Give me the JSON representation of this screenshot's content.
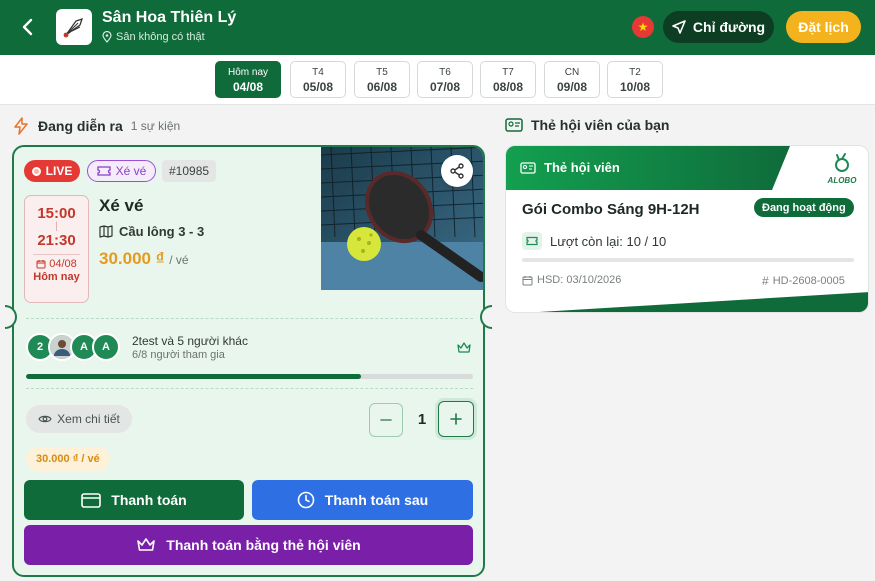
{
  "header": {
    "venue_name": "Sân Hoa Thiên Lý",
    "venue_subtitle": "Sân không có thật",
    "directions_label": "Chỉ đường",
    "book_label": "Đặt lịch",
    "flag_icon": "vietnam-flag-icon"
  },
  "dates": [
    {
      "dow": "Hôm nay",
      "date": "04/08",
      "active": true
    },
    {
      "dow": "T4",
      "date": "05/08",
      "active": false
    },
    {
      "dow": "T5",
      "date": "06/08",
      "active": false
    },
    {
      "dow": "T6",
      "date": "07/08",
      "active": false
    },
    {
      "dow": "T7",
      "date": "08/08",
      "active": false
    },
    {
      "dow": "CN",
      "date": "09/08",
      "active": false
    },
    {
      "dow": "T2",
      "date": "10/08",
      "active": false
    }
  ],
  "live_section": {
    "title": "Đang diễn ra",
    "count": "1 sự kiện"
  },
  "event": {
    "live_label": "LIVE",
    "ticket_tag": "Xé vé",
    "code": "#10985",
    "start_time": "15:00",
    "end_time": "21:30",
    "date": "04/08",
    "day_label": "Hôm nay",
    "name": "Xé vé",
    "court": "Cầu lông 3 - 3",
    "price": "30.000 ₫",
    "price_unit": "/ vé",
    "avatars": [
      {
        "text": "2",
        "color": "#1f8a55"
      },
      {
        "text": "",
        "color": "#7a8a80"
      },
      {
        "text": "A",
        "color": "#1f8a55"
      },
      {
        "text": "A",
        "color": "#1f8a55"
      }
    ],
    "participants_main": "2test và 5 người khác",
    "participants_sub": "6/8 người tham gia",
    "fill_fraction": 0.75,
    "detail_label": "Xem chi tiết",
    "quantity": "1",
    "sub_price": "30.000 ₫ / vé",
    "pay_label": "Thanh toán",
    "pay_later_label": "Thanh toán sau",
    "pay_member_label": "Thanh toán bằng thẻ hội viên"
  },
  "membership_section": {
    "title": "Thẻ hội viên của bạn"
  },
  "membership": {
    "card_title": "Thẻ hội viên",
    "brand": "ALOBO",
    "plan": "Gói Combo Sáng 9H-12H",
    "status": "Đang hoạt động",
    "remaining": "Lượt còn lại: 10 / 10",
    "expiry": "HSD: 03/10/2026",
    "card_no": "HD-2608-0005"
  },
  "colors": {
    "primary": "#0f6b3a",
    "accent": "#f4b31c",
    "live": "#e53935",
    "pay_later": "#2f6fe4",
    "member": "#7a1fa8",
    "price": "#e39b1f"
  }
}
